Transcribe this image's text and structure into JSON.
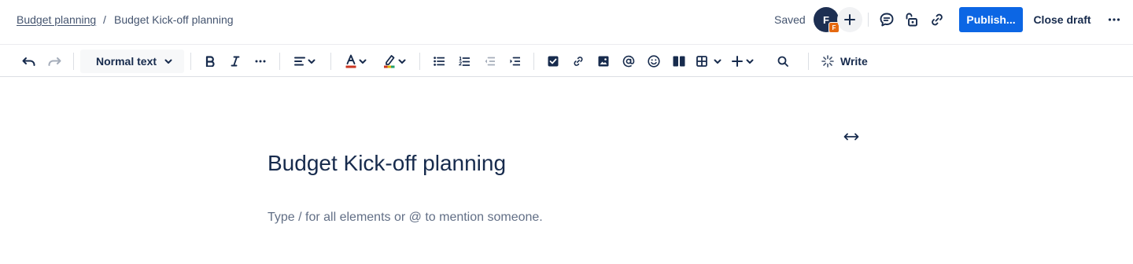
{
  "breadcrumb": {
    "parent": "Budget planning",
    "separator": "/",
    "current": "Budget Kick-off planning"
  },
  "header": {
    "save_status": "Saved",
    "avatar_initial": "F",
    "avatar_badge": "F",
    "publish_label": "Publish...",
    "close_draft_label": "Close draft",
    "icons": [
      "add-collaborator-icon",
      "comment-icon",
      "restrictions-lock-icon",
      "copy-link-icon",
      "more-icon"
    ]
  },
  "toolbar": {
    "text_style": "Normal text",
    "write_label": "Write",
    "icons": [
      "undo-icon",
      "redo-icon",
      "chevron-down-icon",
      "bold-icon",
      "italic-icon",
      "more-formatting-icon",
      "align-icon",
      "text-color-icon",
      "highlight-icon",
      "bullet-list-icon",
      "numbered-list-icon",
      "outdent-icon",
      "indent-icon",
      "task-icon",
      "link-icon",
      "image-icon",
      "mention-icon",
      "emoji-icon",
      "layouts-icon",
      "table-icon",
      "insert-icon",
      "find-icon",
      "ai-sparkle-icon"
    ]
  },
  "content": {
    "title": "Budget Kick-off planning",
    "placeholder": "Type / for all elements or @ to mention someone."
  },
  "colors": {
    "primary": "#0c66e4",
    "text": "#172b4d",
    "subtle_text": "#44546f",
    "avatar_bg": "#1d2f52",
    "avatar_badge": "#e56910",
    "text_color_underline": "#ca3521",
    "highlight_underline": "multicolor"
  }
}
